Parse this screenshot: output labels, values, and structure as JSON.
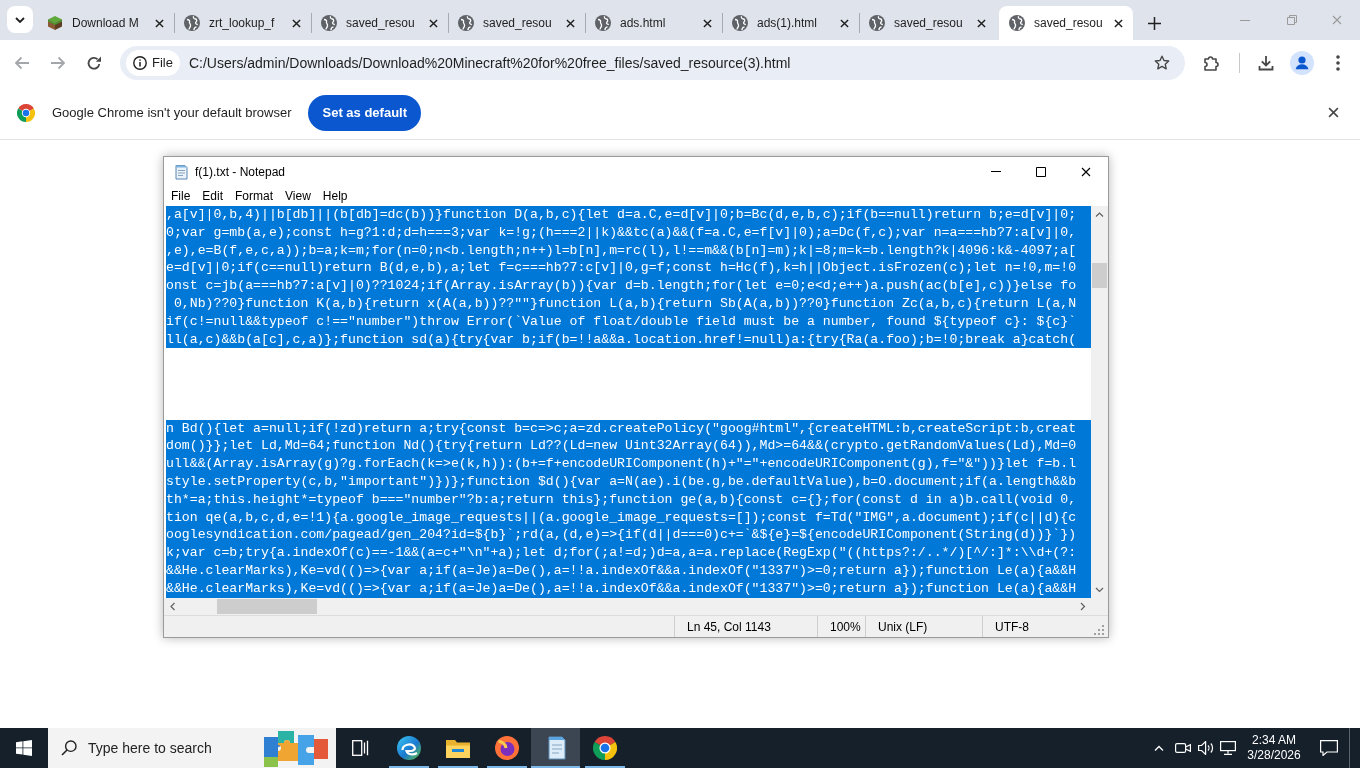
{
  "tabs": [
    {
      "title": "Download M",
      "kind": "block",
      "selected": false
    },
    {
      "title": "zrt_lookup_f",
      "kind": "globe",
      "selected": false
    },
    {
      "title": "saved_resou",
      "kind": "globe",
      "selected": false
    },
    {
      "title": "saved_resou",
      "kind": "globe",
      "selected": false
    },
    {
      "title": "ads.html",
      "kind": "globe",
      "selected": false
    },
    {
      "title": "ads(1).html",
      "kind": "globe",
      "selected": false
    },
    {
      "title": "saved_resou",
      "kind": "globe",
      "selected": false
    },
    {
      "title": "saved_resou",
      "kind": "globe",
      "selected": true
    }
  ],
  "address_bar": {
    "chip": "File",
    "url": "C:/Users/admin/Downloads/Download%20Minecraft%20for%20free_files/saved_resource(3).html"
  },
  "infobar": {
    "message": "Google Chrome isn't your default browser",
    "button": "Set as default"
  },
  "notepad": {
    "title": "f(1).txt - Notepad",
    "menu": [
      "File",
      "Edit",
      "Format",
      "View",
      "Help"
    ],
    "lines": [
      {
        "kind": "code",
        "text": ",a[v]|0,b,4)||b[db]||(b[db]=dc(b))}function D(a,b,c){let d=a.C,e=d[v]|0;b=Bc(d,e,b,c);if(b==null)return b;e=d[v]|0;",
        "selected": true
      },
      {
        "kind": "code",
        "text": "0;var g=mb(a,e);const h=g?1:d;d=h===3;var k=!g;(h===2||k)&&tc(a)&&(f=a.C,e=f[v]|0);a=Dc(f,c);var n=a===hb?7:a[v]|0,",
        "selected": true
      },
      {
        "kind": "code",
        "text": ",e),e=B(f,e,c,a));b=a;k=m;for(n=0;n<b.length;n++)l=b[n],m=rc(l),l!==m&&(b[n]=m);k|=8;m=k=b.length?k|4096:k&-4097;a[",
        "selected": true
      },
      {
        "kind": "code",
        "text": "e=d[v]|0;if(c==null)return B(d,e,b),a;let f=c===hb?7:c[v]|0,g=f;const h=Hc(f),k=h||Object.isFrozen(c);let n=!0,m=!0",
        "selected": true
      },
      {
        "kind": "code",
        "text": "onst c=jb(a===hb?7:a[v]|0)??1024;if(Array.isArray(b)){var d=b.length;for(let e=0;e<d;e++)a.push(ac(b[e],c))}else fo",
        "selected": true
      },
      {
        "kind": "code",
        "text": " 0,Nb)??0}function K(a,b){return x(A(a,b))??\"\"}function L(a,b){return Sb(A(a,b))??0}function Zc(a,b,c){return L(a,N",
        "selected": true
      },
      {
        "kind": "code",
        "text": "if(c!=null&&typeof c!==\"number\")throw Error(`Value of float/double field must be a number, found ${typeof c}: ${c}`",
        "selected": true
      },
      {
        "kind": "code",
        "text": "ll(a,c)&&b(a[c],c,a)};function sd(a){try{var b;if(b=!!a&&a.location.href!=null)a:{try{Ra(a.foo);b=!0;break a}catch(",
        "selected": true
      },
      {
        "kind": "blank"
      },
      {
        "kind": "blank"
      },
      {
        "kind": "blank"
      },
      {
        "kind": "blank"
      },
      {
        "kind": "code",
        "text": "n Bd(){let a=null;if(!zd)return a;try{const b=c=>c;a=zd.createPolicy(\"goog#html\",{createHTML:b,createScript:b,creat",
        "selected": true
      },
      {
        "kind": "code",
        "text": "dom()}};let Ld,Md=64;function Nd(){try{return Ld??(Ld=new Uint32Array(64)),Md>=64&&(crypto.getRandomValues(Ld),Md=0",
        "selected": true
      },
      {
        "kind": "code",
        "text": "ull&&(Array.isArray(g)?g.forEach(k=>e(k,h)):(b+=f+encodeURIComponent(h)+\"=\"+encodeURIComponent(g),f=\"&\"))}let f=b.l",
        "selected": true
      },
      {
        "kind": "code",
        "text": "style.setProperty(c,b,\"important\")})};function $d(){var a=N(ae).i(be.g,be.defaultValue),b=O.document;if(a.length&&b",
        "selected": true
      },
      {
        "kind": "code",
        "text": "th*=a;this.height*=typeof b===\"number\"?b:a;return this};function ge(a,b){const c={};for(const d in a)b.call(void 0,",
        "selected": true
      },
      {
        "kind": "code",
        "text": "tion qe(a,b,c,d,e=!1){a.google_image_requests||(a.google_image_requests=[]);const f=Td(\"IMG\",a.document);if(c||d){c",
        "selected": true
      },
      {
        "kind": "code",
        "text": "ooglesyndication.com/pagead/gen_204?id=${b}`;rd(a,(d,e)=>{if(d||d===0)c+=`&${e}=${encodeURIComponent(String(d))}`})",
        "selected": true
      },
      {
        "kind": "code",
        "text": "k;var c=b;try{a.indexOf(c)==-1&&(a=c+\"\\n\"+a);let d;for(;a!=d;)d=a,a=a.replace(RegExp(\"((https?:/..*/)[^/:]*:\\\\d+(?:",
        "selected": true
      },
      {
        "kind": "code",
        "text": "&&He.clearMarks),Ke=vd(()=>{var a;if(a=Je)a=De(),a=!!a.indexOf&&a.indexOf(\"1337\")>=0;return a});function Le(a){a&&H",
        "selected": true
      },
      {
        "kind": "code",
        "text": "&&He.clearMarks),Ke=vd(()=>{var a;if(a=Je)a=De(),a=!!a.indexOf&&a.indexOf(\"1337\")>=0;return a});function Le(a){a&&H",
        "selected": true
      }
    ],
    "status": [
      "Ln 45, Col 1143",
      "100%",
      "Unix (LF)",
      "UTF-8"
    ]
  },
  "taskbar": {
    "search": {
      "placeholder": "Type here to search"
    },
    "apps": [
      {
        "kind": "edge",
        "running": true,
        "selected": false
      },
      {
        "kind": "explorer",
        "running": true,
        "selected": false
      },
      {
        "kind": "firefox",
        "running": true,
        "selected": false
      },
      {
        "kind": "notepad",
        "running": true,
        "selected": true
      },
      {
        "kind": "chrome",
        "running": true,
        "selected": false
      }
    ],
    "time": "2:34 AM",
    "date": "3/28/2026"
  }
}
